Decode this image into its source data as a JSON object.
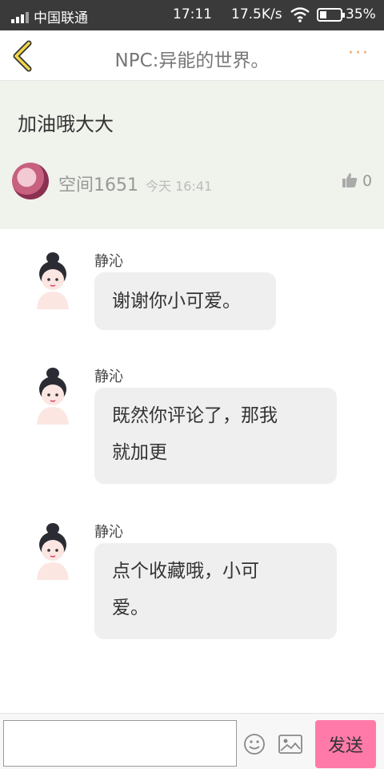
{
  "status_bar": {
    "carrier": "中国联通",
    "time": "17:11",
    "speed": "17.5K/s",
    "battery": "35%",
    "battery_level": 0.35
  },
  "nav": {
    "title": "NPC:异能的世界。",
    "back_icon": "chevron-left-icon",
    "more_icon": "more-dots-icon",
    "more_label": "···"
  },
  "comment": {
    "text": "加油哦大大",
    "user": "空间1651",
    "time": "今天 16:41",
    "likes": "0",
    "like_icon": "thumbs-up-icon"
  },
  "messages": [
    {
      "sender": "静沁",
      "lines": [
        "谢谢你小可爱。"
      ]
    },
    {
      "sender": "静沁",
      "lines": [
        "既然你评论了，那我",
        "就加更"
      ]
    },
    {
      "sender": "静沁",
      "lines": [
        "点个收藏哦，小可",
        "爱。"
      ]
    }
  ],
  "input_bar": {
    "placeholder": "",
    "send_label": "发送",
    "emoji_icon": "emoji-icon",
    "image_icon": "image-icon"
  },
  "colors": {
    "accent": "#ff7aa8",
    "more_dots": "#f0a060",
    "comment_bg": "#f0f2ec",
    "bubble_bg": "#efefef"
  }
}
